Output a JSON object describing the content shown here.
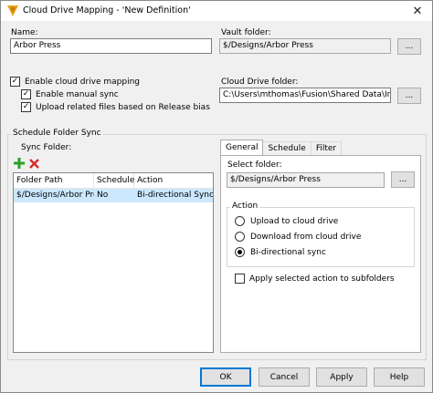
{
  "window": {
    "title": "Cloud Drive Mapping - 'New Definition'",
    "close_glyph": "✕"
  },
  "name": {
    "label": "Name:",
    "value": "Arbor Press"
  },
  "vault_folder": {
    "label": "Vault folder:",
    "value": "$/Designs/Arbor Press",
    "browse_label": "..."
  },
  "options": {
    "enable_cloud": {
      "label": "Enable cloud drive mapping",
      "checked": true
    },
    "manual_sync": {
      "label": "Enable manual sync",
      "checked": true
    },
    "upload_related": {
      "label": "Upload related files based on Release bias",
      "checked": true
    }
  },
  "cloud_drive_folder": {
    "label": "Cloud Drive folder:",
    "value": "C:\\Users\\mthomas\\Fusion\\Shared Data\\Inventor an",
    "browse_label": "..."
  },
  "schedule": {
    "title": "Schedule Folder Sync",
    "sync_folder_label": "Sync Folder:",
    "add_icon": "plus-icon",
    "remove_icon": "x-icon",
    "columns": [
      "Folder Path",
      "Scheduled",
      "Action"
    ],
    "rows": [
      {
        "folder_path": "$/Designs/Arbor Press",
        "scheduled": "No",
        "action": "Bi-directional Sync"
      }
    ]
  },
  "tabs": [
    {
      "label": "General",
      "active": true
    },
    {
      "label": "Schedule",
      "active": false
    },
    {
      "label": "Filter",
      "active": false
    }
  ],
  "general": {
    "select_folder_label": "Select folder:",
    "select_folder_value": "$/Designs/Arbor Press",
    "browse_label": "...",
    "action_group_title": "Action",
    "radios": [
      {
        "label": "Upload to cloud drive",
        "selected": false
      },
      {
        "label": "Download from cloud drive",
        "selected": false
      },
      {
        "label": "Bi-directional sync",
        "selected": true
      }
    ],
    "apply_subfolders": {
      "label": "Apply selected action to subfolders",
      "checked": false
    }
  },
  "buttons": {
    "ok": "OK",
    "cancel": "Cancel",
    "apply": "Apply",
    "help": "Help"
  },
  "colors": {
    "accent": "#0078d7",
    "selection": "#cce8ff",
    "add_green": "#2aa12a",
    "remove_red": "#d62b2b"
  }
}
